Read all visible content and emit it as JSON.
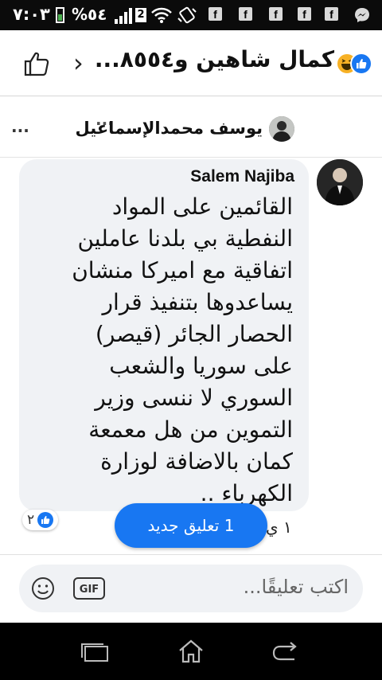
{
  "status_bar": {
    "time": "٧:٠٣",
    "battery": "%٥٤",
    "sim_badge": "2",
    "app_icon_glyph": "f",
    "colors": {
      "background": "#0b0b0b"
    }
  },
  "header": {
    "title": "كمال شاهين و٨٥٥٤...",
    "chevron": "›",
    "clipped_text": "...",
    "icons": [
      "like-outline-icon",
      "chevron-icon",
      "haha-reaction-icon",
      "like-reaction-icon"
    ]
  },
  "reply_preview": {
    "name": "يوسف محمدالإسماعيل",
    "ellipsis": "..."
  },
  "comment": {
    "author": "Salem Najiba",
    "text": "القائمين على المواد\nالنفطية بي بلدنا عاملين\nاتفاقية مع اميركا منشان\nيساعدوها بتنفيذ قرار\nالحصار الجائر (قيصر)\nعلى سوريا والشعب\nالسوري لا ننسى وزير\nالتموين من هل معمعة\nكمان بالاضافة لوزارة\nالكهرباء ..",
    "likes": "٢",
    "time_partial": "١ ي"
  },
  "new_comment_pill": {
    "label": "1 تعليق جديد"
  },
  "composer": {
    "placeholder": "اكتب تعليقًا...",
    "gif_label": "GIF"
  },
  "colors": {
    "accent": "#1877f2",
    "bubble": "#f0f2f5",
    "haha": "#f7b125"
  }
}
